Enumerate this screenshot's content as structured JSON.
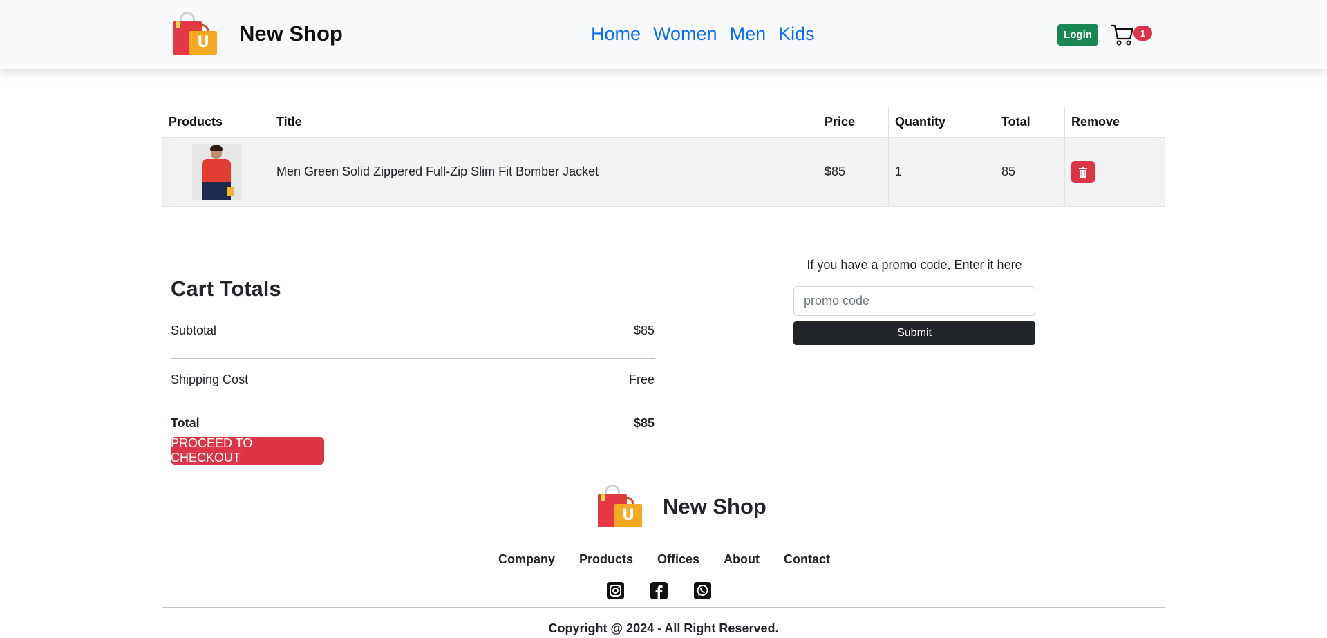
{
  "header": {
    "brand": "New Shop",
    "nav": [
      "Home",
      "Women",
      "Men",
      "Kids"
    ],
    "login_label": "Login",
    "cart_count": "1",
    "logo_letter": "U"
  },
  "table": {
    "headers": [
      "Products",
      "Title",
      "Price",
      "Quantity",
      "Total",
      "Remove"
    ],
    "rows": [
      {
        "title": "Men Green Solid Zippered Full-Zip Slim Fit Bomber Jacket",
        "price": "$85",
        "quantity": "1",
        "total": "85"
      }
    ]
  },
  "totals": {
    "heading": "Cart Totals",
    "subtotal_label": "Subtotal",
    "subtotal_value": "$85",
    "shipping_label": "Shipping Cost",
    "shipping_value": "Free",
    "total_label": "Total",
    "total_value": "$85",
    "checkout_label": "PROCEED TO CHECKOUT"
  },
  "promo": {
    "label": "If you have a promo code, Enter it here",
    "placeholder": "promo code",
    "submit_label": "Submit"
  },
  "footer": {
    "brand": "New Shop",
    "logo_letter": "U",
    "links": [
      "Company",
      "Products",
      "Offices",
      "About",
      "Contact"
    ],
    "socials": [
      "instagram-icon",
      "facebook-icon",
      "whatsapp-icon"
    ],
    "copyright": "Copyright @ 2024 - All Right Reserved."
  },
  "colors": {
    "primary": "#0d6efd",
    "success": "#198754",
    "danger": "#dc3545",
    "dark": "#212529"
  }
}
